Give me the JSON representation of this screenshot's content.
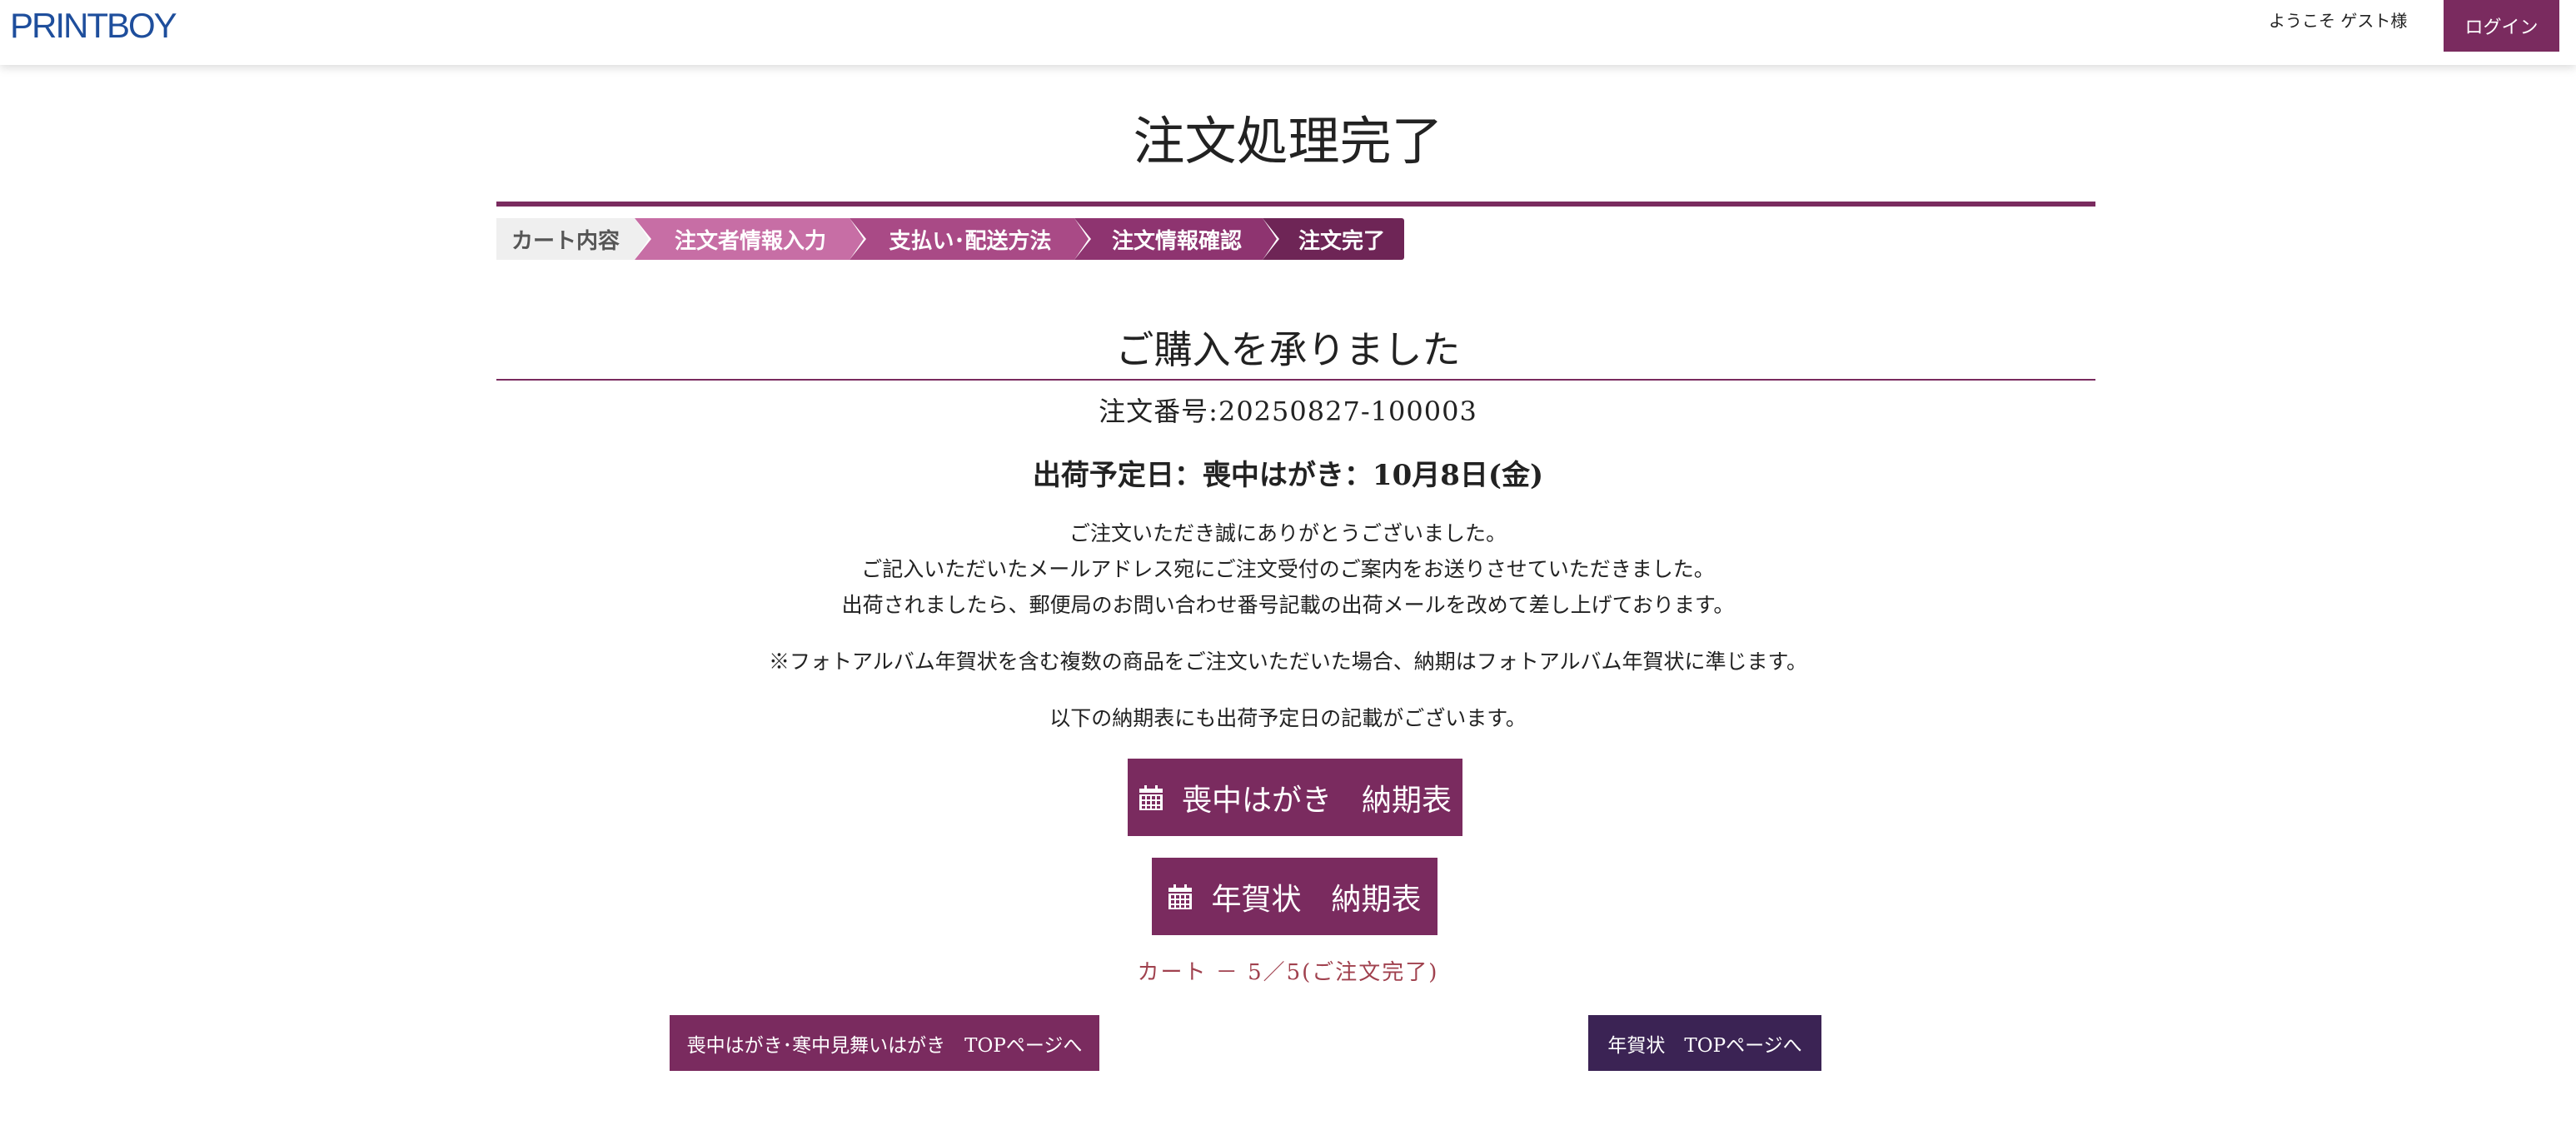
{
  "header": {
    "logo": "PRINTBOY",
    "welcome": "ようこそ ゲスト様",
    "login_label": "ログイン"
  },
  "page_title": "注文処理完了",
  "steps": [
    {
      "label": "カート内容"
    },
    {
      "label": "注文者情報入力"
    },
    {
      "label": "支払い･配送方法"
    },
    {
      "label": "注文情報確認"
    },
    {
      "label": "注文完了"
    }
  ],
  "section_title": "ご購入を承りました",
  "order_number": "注文番号:20250827-100003",
  "ship_date": "出荷予定日：喪中はがき：10月8日(金)",
  "messages": [
    "ご注文いただき誠にありがとうございました。",
    "ご記入いただいたメールアドレス宛にご注文受付のご案内をお送りさせていただきました。",
    "出荷されましたら、郵便局のお問い合わせ番号記載の出荷メールを改めて差し上げております。",
    "※フォトアルバム年賀状を含む複数の商品をご注文いただいた場合、納期はフォトアルバム年賀状に準じます。",
    "以下の納期表にも出荷予定日の記載がございます。"
  ],
  "buttons": {
    "mochu_schedule": "喪中はがき　納期表",
    "nenga_schedule": "年賀状　納期表"
  },
  "icons": {
    "calendar": "calendar-icon"
  },
  "cart_status": "カート － 5／5(ご注文完了)",
  "nav": {
    "mochu_top": "喪中はがき･寒中見舞いはがき　TOPページへ",
    "nenga_top": "年賀状　TOPページへ"
  },
  "colors": {
    "brand": "#7a2b5f",
    "logo": "#1e4e9c",
    "nenga_nav": "#3b2354",
    "cart_status": "#a0414e"
  }
}
